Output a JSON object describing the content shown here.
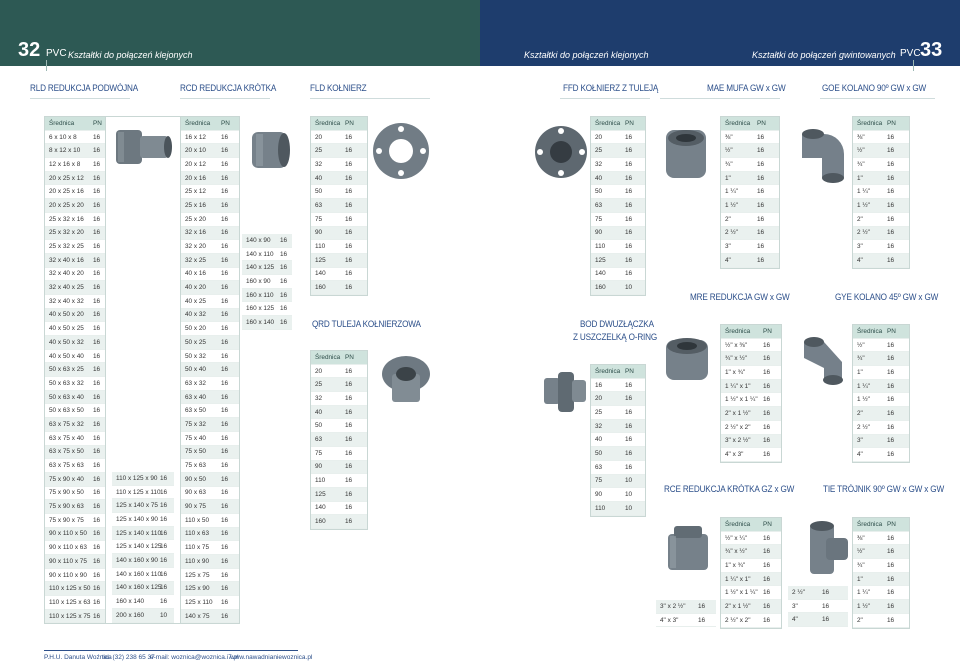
{
  "header": {
    "left_page": "32",
    "left_pvc": "PVC",
    "left_title": "Kształtki do połączeń klejonych",
    "center_title": "Kształtki do połączeń klejonych",
    "right_title": "Kształtki do połączeń gwintowanych",
    "right_pvc": "PVC",
    "right_page": "33"
  },
  "sections": {
    "rld": "RLD REDUKCJA PODWÓJNA",
    "rcd": "RCD REDUKCJA KRÓTKA",
    "fld": "FLD KOŁNIERZ",
    "ffd": "FFD KOŁNIERZ Z TULEJĄ",
    "mae": "MAE MUFA GW x GW",
    "goe": "GOE KOLANO 90º GW x GW",
    "qrd": "QRD TULEJA KOŁNIERZOWA",
    "bod": "BOD DWUZŁĄCZKA",
    "bod2": "Z USZCZELKĄ O-RING",
    "mre": "MRE REDUKCJA GW x GW",
    "gye": "GYE KOLANO 45º GW x GW",
    "rce": "RCE REDUKCJA KRÓTKA GZ x GW",
    "tie": "TIE TRÓJNIK 90º GW x GW x GW"
  },
  "col": {
    "srednica": "Średnica",
    "pn": "PN"
  },
  "rld": [
    [
      "6 x 10 x 8",
      "16"
    ],
    [
      "8 x 12 x 10",
      "16"
    ],
    [
      "12 x 16 x 8",
      "16"
    ],
    [
      "20 x 25 x 12",
      "16"
    ],
    [
      "20 x 25 x 16",
      "16"
    ],
    [
      "20 x 25 x 20",
      "16"
    ],
    [
      "25 x 32 x 16",
      "16"
    ],
    [
      "25 x 32 x 20",
      "16"
    ],
    [
      "25 x 32 x 25",
      "16"
    ],
    [
      "32 x 40 x 16",
      "16"
    ],
    [
      "32 x 40 x 20",
      "16"
    ],
    [
      "32 x 40 x 25",
      "16"
    ],
    [
      "32 x 40 x 32",
      "16"
    ],
    [
      "40 x 50 x 20",
      "16"
    ],
    [
      "40 x 50 x 25",
      "16"
    ],
    [
      "40 x 50 x 32",
      "16"
    ],
    [
      "40 x 50 x 40",
      "16"
    ],
    [
      "50 x 63 x 25",
      "16"
    ],
    [
      "50 x 63 x 32",
      "16"
    ],
    [
      "50 x 63 x 40",
      "16"
    ],
    [
      "50 x 63 x 50",
      "16"
    ],
    [
      "63 x 75 x 32",
      "16"
    ],
    [
      "63 x 75 x 40",
      "16"
    ],
    [
      "63 x 75 x 50",
      "16"
    ],
    [
      "63 x 75 x 63",
      "16"
    ],
    [
      "75 x 90 x 40",
      "16"
    ],
    [
      "75 x 90 x 50",
      "16"
    ],
    [
      "75 x 90 x 63",
      "16"
    ],
    [
      "75 x 90 x 75",
      "16"
    ],
    [
      "90 x 110 x 50",
      "16"
    ],
    [
      "90 x 110 x 63",
      "16"
    ],
    [
      "90 x 110 x 75",
      "16"
    ],
    [
      "90 x 110 x 90",
      "16"
    ],
    [
      "110 x 125 x 50",
      "16"
    ],
    [
      "110 x 125 x 63",
      "16"
    ],
    [
      "110 x 125 x 75",
      "16"
    ]
  ],
  "rld2": [
    [
      "110 x 125 x 90",
      "16"
    ],
    [
      "110 x 125 x 110",
      "16"
    ],
    [
      "125 x 140 x 75",
      "16"
    ],
    [
      "125 x 140 x 90",
      "16"
    ],
    [
      "125 x 140 x 110",
      "16"
    ],
    [
      "125 x 140 x 125",
      "16"
    ],
    [
      "140 x 160 x 90",
      "16"
    ],
    [
      "140 x 160 x 110",
      "16"
    ],
    [
      "140 x 160 x 125",
      "16"
    ],
    [
      "160 x 140",
      "16"
    ],
    [
      "200 x 160",
      "10"
    ]
  ],
  "rcd": [
    [
      "16 x 12",
      "16"
    ],
    [
      "20 x 10",
      "16"
    ],
    [
      "20 x 12",
      "16"
    ],
    [
      "20 x 16",
      "16"
    ],
    [
      "25 x 12",
      "16"
    ],
    [
      "25 x 16",
      "16"
    ],
    [
      "25 x 20",
      "16"
    ],
    [
      "32 x 16",
      "16"
    ],
    [
      "32 x 20",
      "16"
    ],
    [
      "32 x 25",
      "16"
    ],
    [
      "40 x 16",
      "16"
    ],
    [
      "40 x 20",
      "16"
    ],
    [
      "40 x 25",
      "16"
    ],
    [
      "40 x 32",
      "16"
    ],
    [
      "50 x 20",
      "16"
    ],
    [
      "50 x 25",
      "16"
    ],
    [
      "50 x 32",
      "16"
    ],
    [
      "50 x 40",
      "16"
    ],
    [
      "63 x 32",
      "16"
    ],
    [
      "63 x 40",
      "16"
    ],
    [
      "63 x 50",
      "16"
    ],
    [
      "75 x 32",
      "16"
    ],
    [
      "75 x 40",
      "16"
    ],
    [
      "75 x 50",
      "16"
    ],
    [
      "75 x 63",
      "16"
    ],
    [
      "90 x 50",
      "16"
    ],
    [
      "90 x 63",
      "16"
    ],
    [
      "90 x 75",
      "16"
    ],
    [
      "110 x 50",
      "16"
    ],
    [
      "110 x 63",
      "16"
    ],
    [
      "110 x 75",
      "16"
    ],
    [
      "110 x 90",
      "16"
    ],
    [
      "125 x 75",
      "16"
    ],
    [
      "125 x 90",
      "16"
    ],
    [
      "125 x 110",
      "16"
    ],
    [
      "140 x 75",
      "16"
    ]
  ],
  "rcd2": [
    [
      "140 x 90",
      "16"
    ],
    [
      "140 x 110",
      "16"
    ],
    [
      "140 x 125",
      "16"
    ],
    [
      "160 x 90",
      "16"
    ],
    [
      "160 x 110",
      "16"
    ],
    [
      "160 x 125",
      "16"
    ],
    [
      "160 x 140",
      "16"
    ]
  ],
  "fld": [
    [
      "20",
      "16"
    ],
    [
      "25",
      "16"
    ],
    [
      "32",
      "16"
    ],
    [
      "40",
      "16"
    ],
    [
      "50",
      "16"
    ],
    [
      "63",
      "16"
    ],
    [
      "75",
      "16"
    ],
    [
      "90",
      "16"
    ],
    [
      "110",
      "16"
    ],
    [
      "125",
      "16"
    ],
    [
      "140",
      "16"
    ],
    [
      "160",
      "16"
    ]
  ],
  "qrd": [
    [
      "20",
      "16"
    ],
    [
      "25",
      "16"
    ],
    [
      "32",
      "16"
    ],
    [
      "40",
      "16"
    ],
    [
      "50",
      "16"
    ],
    [
      "63",
      "16"
    ],
    [
      "75",
      "16"
    ],
    [
      "90",
      "16"
    ],
    [
      "110",
      "16"
    ],
    [
      "125",
      "16"
    ],
    [
      "140",
      "16"
    ],
    [
      "160",
      "16"
    ]
  ],
  "ffd": [
    [
      "20",
      "16"
    ],
    [
      "25",
      "16"
    ],
    [
      "32",
      "16"
    ],
    [
      "40",
      "16"
    ],
    [
      "50",
      "16"
    ],
    [
      "63",
      "16"
    ],
    [
      "75",
      "16"
    ],
    [
      "90",
      "16"
    ],
    [
      "110",
      "16"
    ],
    [
      "125",
      "16"
    ],
    [
      "140",
      "16"
    ],
    [
      "160",
      "10"
    ]
  ],
  "bod": [
    [
      "16",
      "16"
    ],
    [
      "20",
      "16"
    ],
    [
      "25",
      "16"
    ],
    [
      "32",
      "16"
    ],
    [
      "40",
      "16"
    ],
    [
      "50",
      "16"
    ],
    [
      "63",
      "16"
    ],
    [
      "75",
      "10"
    ],
    [
      "90",
      "10"
    ],
    [
      "110",
      "10"
    ]
  ],
  "mae": [
    [
      "⅜\"",
      "16"
    ],
    [
      "½\"",
      "16"
    ],
    [
      "¾\"",
      "16"
    ],
    [
      "1\"",
      "16"
    ],
    [
      "1 ¼\"",
      "16"
    ],
    [
      "1 ½\"",
      "16"
    ],
    [
      "2\"",
      "16"
    ],
    [
      "2 ½\"",
      "16"
    ],
    [
      "3\"",
      "16"
    ],
    [
      "4\"",
      "16"
    ]
  ],
  "goe": [
    [
      "⅜\"",
      "16"
    ],
    [
      "½\"",
      "16"
    ],
    [
      "¾\"",
      "16"
    ],
    [
      "1\"",
      "16"
    ],
    [
      "1 ¼\"",
      "16"
    ],
    [
      "1 ½\"",
      "16"
    ],
    [
      "2\"",
      "16"
    ],
    [
      "2 ½\"",
      "16"
    ],
    [
      "3\"",
      "16"
    ],
    [
      "4\"",
      "16"
    ]
  ],
  "mre": [
    [
      "½\" x ⅜\"",
      "16"
    ],
    [
      "¾\" x ½\"",
      "16"
    ],
    [
      "1\" x ¾\"",
      "16"
    ],
    [
      "1 ¼\" x 1\"",
      "16"
    ],
    [
      "1 ½\" x 1 ¼\"",
      "16"
    ],
    [
      "2\" x 1 ½\"",
      "16"
    ],
    [
      "2 ½\" x 2\"",
      "16"
    ],
    [
      "3\" x 2 ½\"",
      "16"
    ],
    [
      "4\" x 3\"",
      "16"
    ]
  ],
  "gye": [
    [
      "½\"",
      "16"
    ],
    [
      "¾\"",
      "16"
    ],
    [
      "1\"",
      "16"
    ],
    [
      "1 ¼\"",
      "16"
    ],
    [
      "1 ½\"",
      "16"
    ],
    [
      "2\"",
      "16"
    ],
    [
      "2 ½\"",
      "16"
    ],
    [
      "3\"",
      "16"
    ],
    [
      "4\"",
      "16"
    ]
  ],
  "rce": [
    [
      "½\" x ¼\"",
      "16"
    ],
    [
      "¾\" x ½\"",
      "16"
    ],
    [
      "1\" x ¾\"",
      "16"
    ],
    [
      "1 ¼\" x 1\"",
      "16"
    ],
    [
      "1 ½\" x 1 ¼\"",
      "16"
    ],
    [
      "2\" x 1 ½\"",
      "16"
    ],
    [
      "2 ½\" x 2\"",
      "16"
    ]
  ],
  "rce2": [
    [
      "3\" x 2 ½\"",
      "16"
    ],
    [
      "4\" x 3\"",
      "16"
    ]
  ],
  "tie": [
    [
      "⅜\"",
      "16"
    ],
    [
      "½\"",
      "16"
    ],
    [
      "¾\"",
      "16"
    ],
    [
      "1\"",
      "16"
    ],
    [
      "1 ¼\"",
      "16"
    ],
    [
      "1 ½\"",
      "16"
    ],
    [
      "2\"",
      "16"
    ]
  ],
  "tie2": [
    [
      "2 ½\"",
      "16"
    ],
    [
      "3\"",
      "16"
    ],
    [
      "4\"",
      "16"
    ]
  ],
  "footer": {
    "company": "P.H.U. Danuta Woźnica",
    "tel": "tel. (32) 238 65 37",
    "email": "e-mail: woznica@woznica.i7.pl",
    "web": "www.nawadnianiewoznica.pl"
  },
  "colors": {
    "left_band": "#2d5954",
    "right_band": "#1e3d6d",
    "title": "#2c4f8a",
    "pipe": "#6f7b84"
  }
}
